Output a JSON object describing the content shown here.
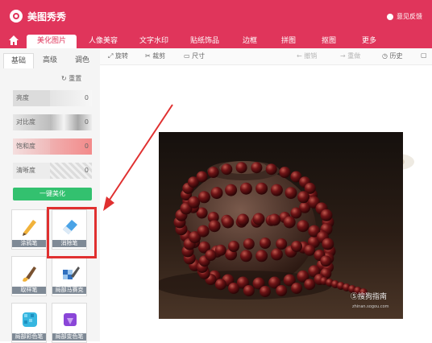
{
  "app": {
    "title": "美图秀秀",
    "feedback": "意见反馈",
    "brand_color": "#e0355b"
  },
  "main_tabs": [
    {
      "label": "美化图片",
      "active": true
    },
    {
      "label": "人像美容"
    },
    {
      "label": "文字水印"
    },
    {
      "label": "贴纸饰品"
    },
    {
      "label": "边框"
    },
    {
      "label": "拼图"
    },
    {
      "label": "抠图"
    },
    {
      "label": "更多"
    }
  ],
  "sub_tabs": [
    {
      "label": "基础",
      "active": true
    },
    {
      "label": "高级"
    },
    {
      "label": "调色"
    }
  ],
  "reset_label": "重置",
  "sliders": [
    {
      "label": "亮度",
      "value": "0"
    },
    {
      "label": "对比度",
      "value": "0"
    },
    {
      "label": "饱和度",
      "value": "0"
    },
    {
      "label": "清晰度",
      "value": "0"
    }
  ],
  "one_key_button": "一键美化",
  "tools": [
    {
      "label": "涂鸦笔",
      "icon": "pen-icon"
    },
    {
      "label": "消除笔",
      "icon": "eraser-icon"
    },
    {
      "label": "取样笔",
      "icon": "brush-icon"
    },
    {
      "label": "局部马赛克",
      "icon": "mosaic-icon"
    },
    {
      "label": "局部彩色笔",
      "icon": "color-pen-icon"
    },
    {
      "label": "局部变色笔",
      "icon": "recolor-pen-icon"
    }
  ],
  "toolbar": {
    "rotate": "旋转",
    "crop": "裁剪",
    "resize": "尺寸",
    "undo": "撤销",
    "redo": "重做",
    "history": "历史"
  },
  "photo": {
    "watermark": "Ⓢ搜狗指南",
    "watermark_url": "zhinan.sogou.com"
  },
  "colors": {
    "highlight": "#e03030",
    "green_button": "#33c16f"
  }
}
